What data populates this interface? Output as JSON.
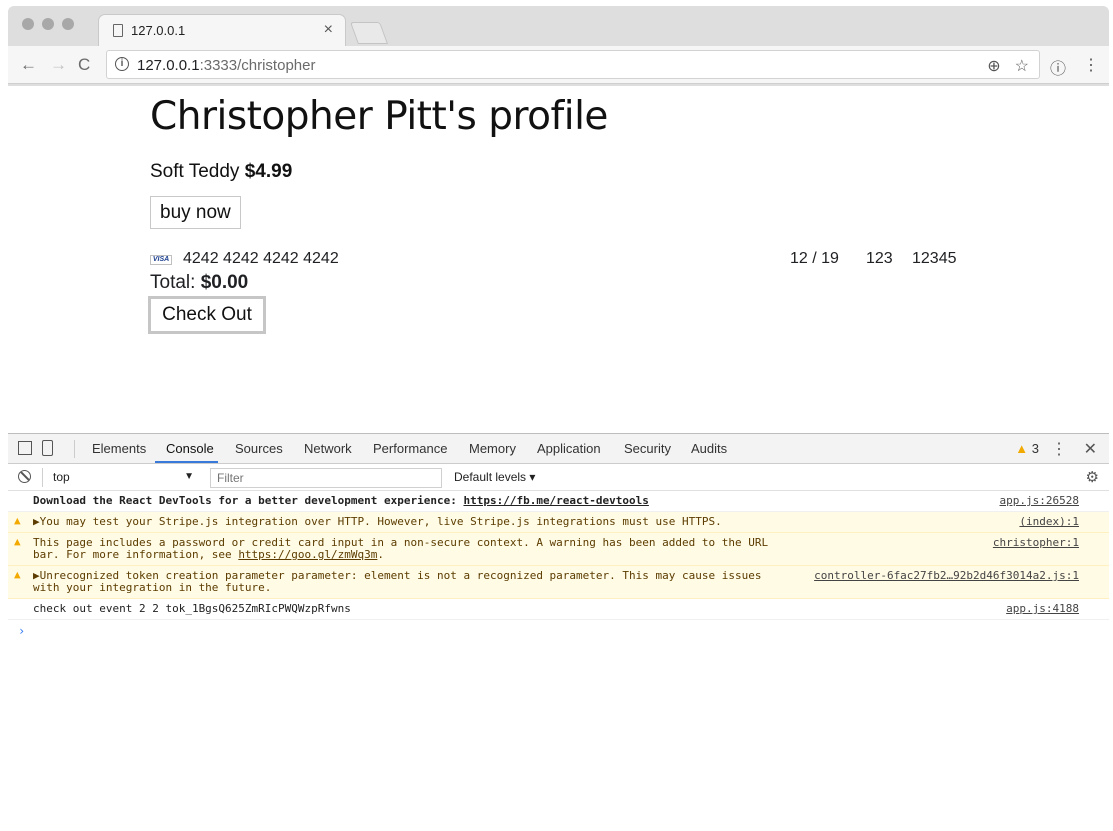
{
  "browser": {
    "tab_title": "127.0.0.1",
    "url_host": "127.0.0.1",
    "url_path": ":3333/christopher"
  },
  "page": {
    "heading": "Christopher Pitt's profile",
    "product_name": "Soft Teddy",
    "product_price": "$4.99",
    "buy_label": "buy now",
    "card": {
      "brand": "VISA",
      "number": "4242 4242 4242 4242",
      "expiry": "12 / 19",
      "cvc": "123",
      "zip": "12345"
    },
    "total_label": "Total:",
    "total_value": "$0.00",
    "checkout_label": "Check Out"
  },
  "devtools": {
    "tabs": [
      "Elements",
      "Console",
      "Sources",
      "Network",
      "Performance",
      "Memory",
      "Application",
      "Security",
      "Audits"
    ],
    "active_tab": "Console",
    "warning_count": "3",
    "context": "top",
    "filter_placeholder": "Filter",
    "levels": "Default levels",
    "messages": [
      {
        "type": "info",
        "text": "Download the React DevTools for a better development experience: ",
        "link": "https://fb.me/react-devtools",
        "source": "app.js:26528"
      },
      {
        "type": "warn",
        "text": "▶You may test your Stripe.js integration over HTTP. However, live Stripe.js integrations must use HTTPS.",
        "source": "(index):1"
      },
      {
        "type": "warn",
        "text": "This page includes a password or credit card input in a non-secure context. A warning has been added to the URL bar. For more information, see ",
        "link": "https://goo.gl/zmWq3m",
        "suffix": ".",
        "source": "christopher:1"
      },
      {
        "type": "warn",
        "text": "▶Unrecognized token creation parameter parameter: element is not a recognized parameter. This may cause issues with your integration in the future.",
        "source": "controller-6fac27fb2…92b2d46f3014a2.js:1"
      },
      {
        "type": "log",
        "text": "check out event 2 2 tok_1BgsQ625ZmRIcPWQWzpRfwns",
        "source": "app.js:4188"
      }
    ]
  },
  "colors": {
    "warning": "#f2a900",
    "active_tab_underline": "#3879d9",
    "prompt": "#367cf1"
  }
}
